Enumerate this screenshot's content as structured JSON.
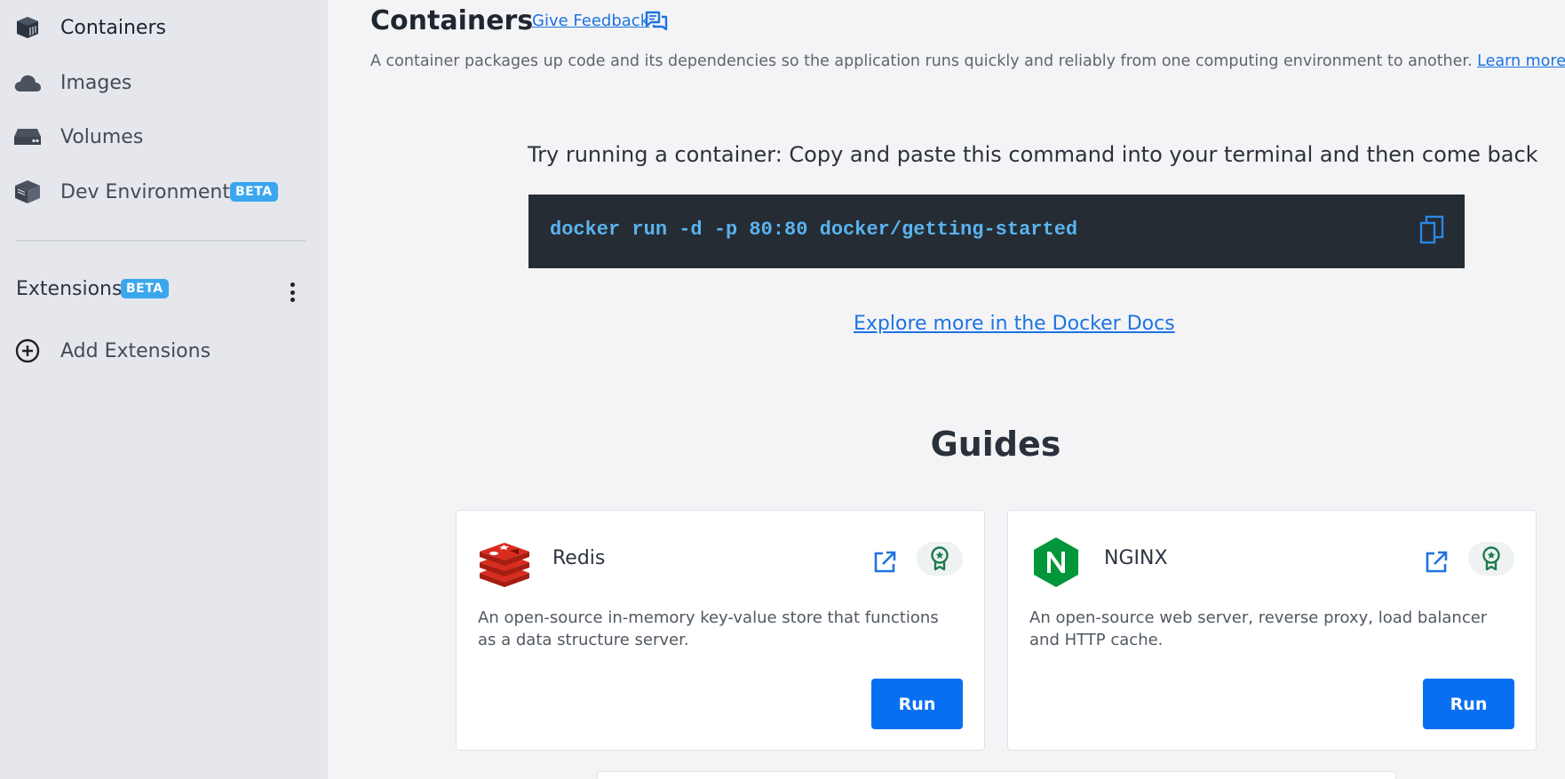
{
  "sidebar": {
    "items": [
      {
        "label": "Containers",
        "icon": "container-icon",
        "active": true
      },
      {
        "label": "Images",
        "icon": "cloud-icon"
      },
      {
        "label": "Volumes",
        "icon": "volume-icon"
      },
      {
        "label": "Dev Environments",
        "icon": "dev-env-icon",
        "badge": "BETA"
      }
    ],
    "extensions": {
      "label": "Extensions",
      "badge": "BETA"
    },
    "add_extensions": {
      "label": "Add Extensions",
      "icon": "plus-circle-icon"
    }
  },
  "header": {
    "title": "Containers",
    "feedback_label": "Give Feedback",
    "description": "A container packages up code and its dependencies so the application runs quickly and reliably from one computing environment to another.",
    "learn_more": "Learn more"
  },
  "getting_started": {
    "instruction": "Try running a container: Copy and paste this command into your terminal and then come back",
    "command": "docker run -d -p 80:80 docker/getting-started",
    "docs_link": "Explore more in the Docker Docs"
  },
  "guides": {
    "title": "Guides",
    "cards": [
      {
        "name": "Redis",
        "logo": "redis-logo",
        "description": "An open-source in-memory key-value store that functions as a data structure server.",
        "run_label": "Run"
      },
      {
        "name": "NGINX",
        "logo": "nginx-logo",
        "description": "An open-source web server, reverse proxy, load balancer and HTTP cache.",
        "run_label": "Run"
      }
    ]
  },
  "colors": {
    "accent": "#0870f0",
    "link": "#1d74e0",
    "beta_badge": "#3aa6ee",
    "command_bg": "#252c33",
    "command_text": "#5ab3ef"
  }
}
